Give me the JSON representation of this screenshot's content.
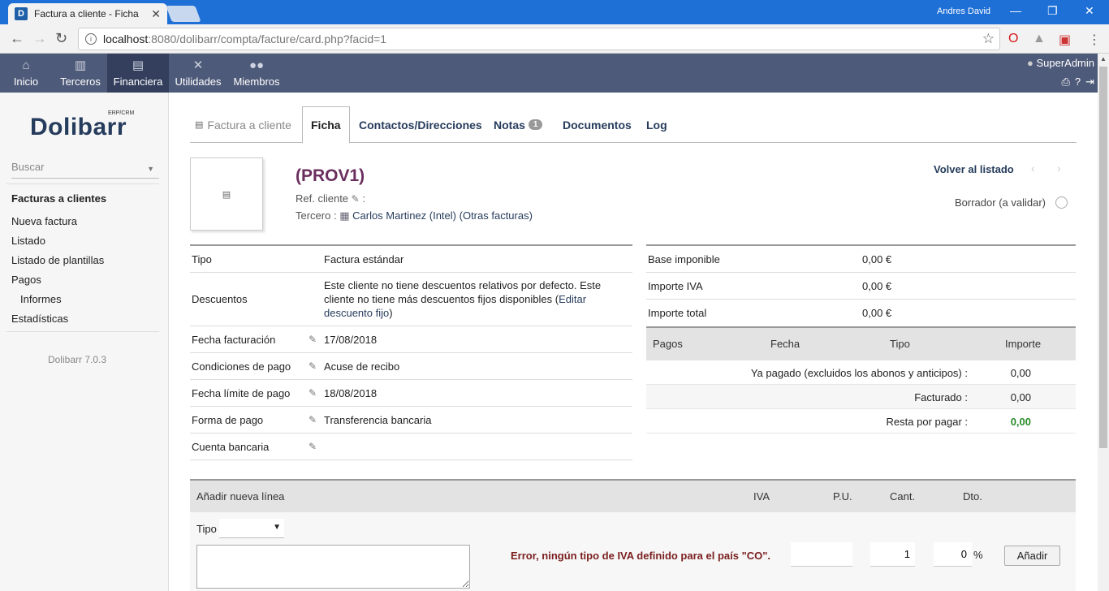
{
  "browser": {
    "tab_title": "Factura a cliente - Ficha",
    "tab_favicon": "D",
    "window_user": "Andres David",
    "url_host": "localhost",
    "url_path": ":8080/dolibarr/compta/facture/card.php?facid=1"
  },
  "topmenu": {
    "items": [
      {
        "label": "Inicio",
        "icon": "home-icon"
      },
      {
        "label": "Terceros",
        "icon": "companies-icon"
      },
      {
        "label": "Financiera",
        "icon": "finance-icon"
      },
      {
        "label": "Utilidades",
        "icon": "tools-icon"
      },
      {
        "label": "Miembros",
        "icon": "members-icon"
      }
    ],
    "user": "SuperAdmin"
  },
  "sidebar": {
    "logo_main": "Dolibarr",
    "logo_sub": "ERP/CRM",
    "search_placeholder": "Buscar",
    "menu_head": "Facturas a clientes",
    "links": [
      "Nueva factura",
      "Listado",
      "Listado de plantillas",
      "Pagos",
      "Informes",
      "Estadísticas"
    ],
    "version": "Dolibarr 7.0.3"
  },
  "tabs": {
    "first": "Factura a cliente",
    "ficha": "Ficha",
    "contactos": "Contactos/Direcciones",
    "notas": "Notas",
    "notas_count": "1",
    "documentos": "Documentos",
    "log": "Log"
  },
  "invoice": {
    "ref": "(PROV1)",
    "ref_cliente_label": "Ref. cliente",
    "tercero_label": "Tercero :",
    "tercero_name": "Carlos Martinez (Intel)",
    "otras_facturas": "(Otras facturas)",
    "back_label": "Volver al listado",
    "status": "Borrador (a validar)"
  },
  "details": {
    "tipo_label": "Tipo",
    "tipo_value": "Factura estándar",
    "descuentos_label": "Descuentos",
    "descuentos_text": "Este cliente no tiene descuentos relativos por defecto. Este cliente no tiene más descuentos fijos disponibles (",
    "descuentos_link": "Editar descuento fijo",
    "descuentos_end": ")",
    "fecha_label": "Fecha facturación",
    "fecha_value": "17/08/2018",
    "condiciones_label": "Condiciones de pago",
    "condiciones_value": "Acuse de recibo",
    "limite_label": "Fecha límite de pago",
    "limite_value": "18/08/2018",
    "forma_label": "Forma de pago",
    "forma_value": "Transferencia bancaria",
    "cuenta_label": "Cuenta bancaria"
  },
  "totals": {
    "base_label": "Base imponible",
    "base_value": "0,00 €",
    "iva_label": "Importe IVA",
    "iva_value": "0,00 €",
    "total_label": "Importe total",
    "total_value": "0,00 €"
  },
  "payments": {
    "headers": [
      "Pagos",
      "Fecha",
      "Tipo",
      "Importe"
    ],
    "pagado_label": "Ya pagado (excluidos los abonos y anticipos) :",
    "pagado_value": "0,00",
    "facturado_label": "Facturado :",
    "facturado_value": "0,00",
    "resta_label": "Resta por pagar :",
    "resta_value": "0,00"
  },
  "addline": {
    "headers": [
      "Añadir nueva línea",
      "IVA",
      "P.U.",
      "Cant.",
      "Dto."
    ],
    "tipo_label": "Tipo",
    "error": "Error, ningún tipo de IVA definido para el país \"CO\".",
    "pu_value": "",
    "cant_value": "1",
    "dto_value": "0",
    "pct": "%",
    "add_button": "Añadir"
  }
}
